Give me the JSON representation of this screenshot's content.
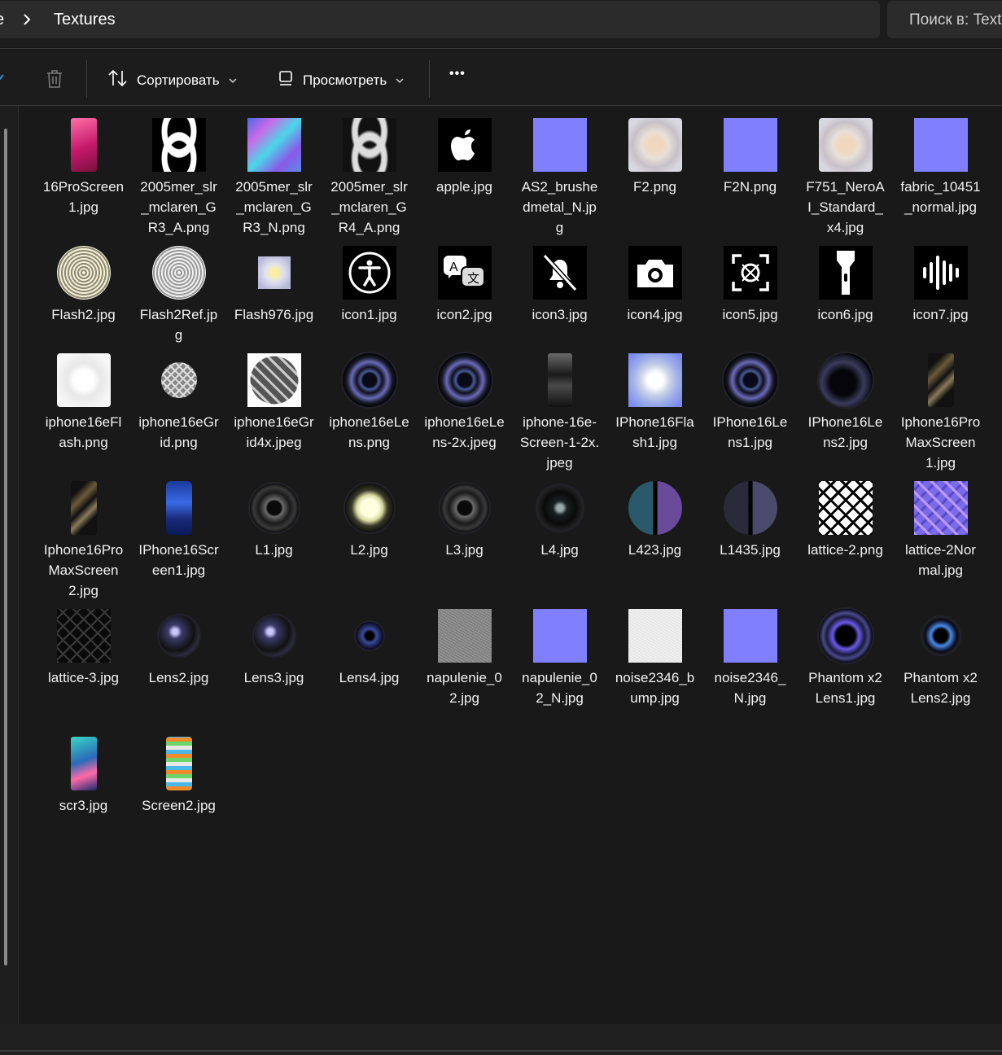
{
  "breadcrumb": {
    "prev": "e",
    "current": "Textures"
  },
  "search": {
    "placeholder": "Поиск в: Textures"
  },
  "toolbar": {
    "sort_label": "Сортировать",
    "view_label": "Просмотреть",
    "more_label": "•••"
  },
  "files": [
    {
      "name": "16ProScreen1.jpg",
      "thumb": "phone-pink"
    },
    {
      "name": "2005mer_slr_mclaren_GR3_A.png",
      "thumb": "lattice-bw"
    },
    {
      "name": "2005mer_slr_mclaren_GR3_N.png",
      "thumb": "lattice-normal"
    },
    {
      "name": "2005mer_slr_mclaren_GR4_A.png",
      "thumb": "lattice-bw-soft"
    },
    {
      "name": "apple.jpg",
      "thumb": "apple"
    },
    {
      "name": "AS2_brushedmetal_N.jpg",
      "thumb": "normal"
    },
    {
      "name": "F2.png",
      "thumb": "flash-soft"
    },
    {
      "name": "F2N.png",
      "thumb": "normal"
    },
    {
      "name": "F751_NeroAI_Standard_x4.jpg",
      "thumb": "flash-soft"
    },
    {
      "name": "fabric_10451_normal.jpg",
      "thumb": "normal"
    },
    {
      "name": "Flash2.jpg",
      "thumb": "flash-gold"
    },
    {
      "name": "Flash2Ref.jpg",
      "thumb": "flash-silver"
    },
    {
      "name": "Flash976.jpg",
      "thumb": "flash-small"
    },
    {
      "name": "icon1.jpg",
      "thumb": "icon-accessibility"
    },
    {
      "name": "icon2.jpg",
      "thumb": "icon-translate"
    },
    {
      "name": "icon3.jpg",
      "thumb": "icon-bell-off"
    },
    {
      "name": "icon4.jpg",
      "thumb": "icon-camera"
    },
    {
      "name": "icon5.jpg",
      "thumb": "icon-scan"
    },
    {
      "name": "icon6.jpg",
      "thumb": "icon-flashlight"
    },
    {
      "name": "icon7.jpg",
      "thumb": "icon-waveform"
    },
    {
      "name": "iphone16eFlash.png",
      "thumb": "flash-white"
    },
    {
      "name": "iphone16eGrid.png",
      "thumb": "grid-small"
    },
    {
      "name": "iphone16eGrid4x.jpeg",
      "thumb": "grid-big"
    },
    {
      "name": "iphone16eLens.png",
      "thumb": "lens"
    },
    {
      "name": "iphone16eLens-2x.jpeg",
      "thumb": "lens"
    },
    {
      "name": "iphone-16e-Screen-1-2x.jpeg",
      "thumb": "phone-dark"
    },
    {
      "name": "IPhone16Flash1.jpg",
      "thumb": "flash-blue"
    },
    {
      "name": "IPhone16Lens1.jpg",
      "thumb": "lens"
    },
    {
      "name": "IPhone16Lens2.jpg",
      "thumb": "lens-dark"
    },
    {
      "name": "Iphone16ProMaxScreen1.jpg",
      "thumb": "phone-gold"
    },
    {
      "name": "Iphone16ProMaxScreen2.jpg",
      "thumb": "phone-gold"
    },
    {
      "name": "IPhone16Screen1.jpg",
      "thumb": "phone-blue"
    },
    {
      "name": "L1.jpg",
      "thumb": "lens-grey"
    },
    {
      "name": "L2.jpg",
      "thumb": "lens-bright"
    },
    {
      "name": "L3.jpg",
      "thumb": "lens-grey"
    },
    {
      "name": "L4.jpg",
      "thumb": "lens-grey-small"
    },
    {
      "name": "L423.jpg",
      "thumb": "lens-split"
    },
    {
      "name": "L1435.jpg",
      "thumb": "lens-split-grey"
    },
    {
      "name": "lattice-2.png",
      "thumb": "lattice-white"
    },
    {
      "name": "lattice-2Normal.jpg",
      "thumb": "lattice-purple"
    },
    {
      "name": "lattice-3.jpg",
      "thumb": "lattice-dark"
    },
    {
      "name": "Lens2.jpg",
      "thumb": "lens-small"
    },
    {
      "name": "Lens3.jpg",
      "thumb": "lens-small"
    },
    {
      "name": "Lens4.jpg",
      "thumb": "lens-tiny"
    },
    {
      "name": "napulenie_02.jpg",
      "thumb": "noise-grey"
    },
    {
      "name": "napulenie_02_N.jpg",
      "thumb": "normal"
    },
    {
      "name": "noise2346_bump.jpg",
      "thumb": "noise-white"
    },
    {
      "name": "noise2346_N.jpg",
      "thumb": "normal"
    },
    {
      "name": "Phantom x2 Lens1.jpg",
      "thumb": "lens-purple"
    },
    {
      "name": "Phantom x2 Lens2.jpg",
      "thumb": "lens-small-blue"
    },
    {
      "name": "scr3.jpg",
      "thumb": "phone-teal"
    },
    {
      "name": "Screen2.jpg",
      "thumb": "phone-apps"
    }
  ]
}
